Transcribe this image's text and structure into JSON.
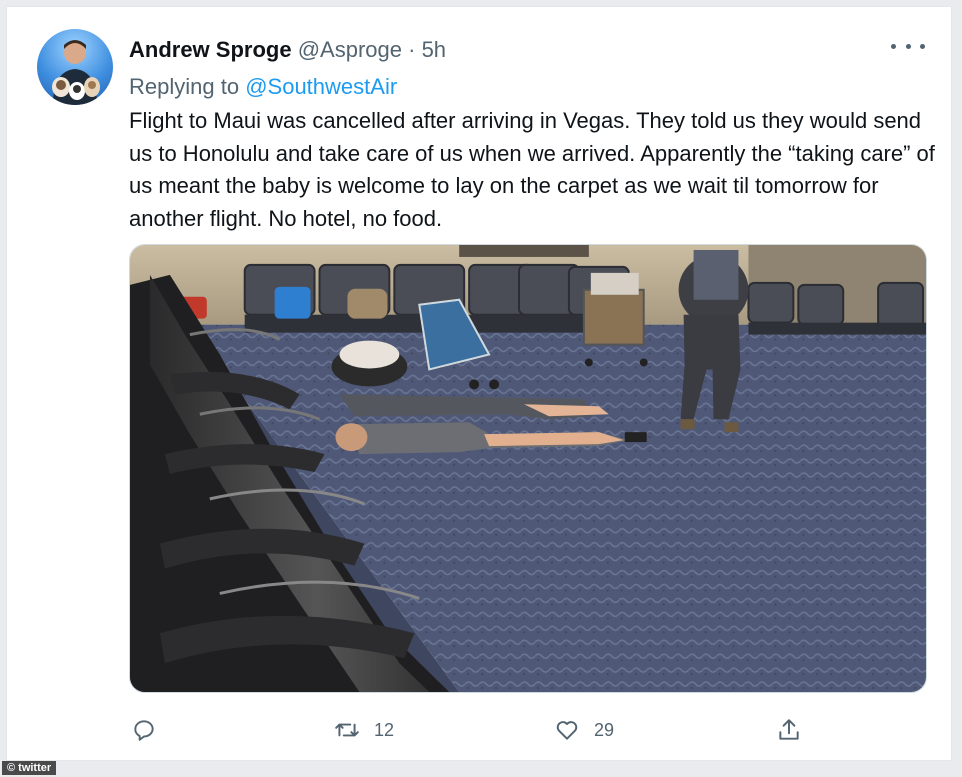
{
  "tweet": {
    "display_name": "Andrew Sproge",
    "handle": "@Asproge",
    "separator": "·",
    "time": "5h",
    "reply_prefix": "Replying to",
    "reply_to": "@SouthwestAir",
    "text": "Flight to Maui was cancelled after arriving in Vegas. They told us they would send us to Honolulu and take care of us when we arrived. Apparently the “taking care” of us meant the baby is welcome to lay on the carpet as we wait til tomorrow for another flight. No hotel, no food."
  },
  "actions": {
    "reply": {
      "icon": "reply-icon",
      "count": ""
    },
    "retweet": {
      "icon": "retweet-icon",
      "count": "12"
    },
    "like": {
      "icon": "heart-icon",
      "count": "29"
    },
    "share": {
      "icon": "share-icon",
      "count": ""
    }
  },
  "menu": {
    "icon": "more-options-icon"
  },
  "watermark": {
    "text": "© twitter"
  },
  "colors": {
    "link": "#1d9bf0",
    "text": "#0f1419",
    "secondary_text": "#536471",
    "border": "#cfd9de"
  }
}
